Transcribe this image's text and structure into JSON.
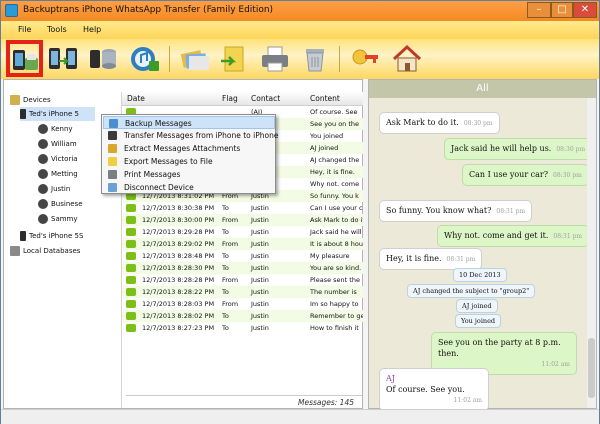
{
  "window": {
    "title": "Backuptrans iPhone WhatsApp Transfer (Family Edition)",
    "min": "–",
    "max": "□",
    "close": "✕"
  },
  "menu": [
    "File",
    "Tools",
    "Help"
  ],
  "toolbar": [
    "backup-messages-icon",
    "transfer-iphone-to-iphone-icon",
    "database-icon",
    "itunes-icon",
    "export-cards-icon",
    "folder-icon",
    "printer-icon",
    "recycle-bin-icon",
    "key-icon",
    "home-icon"
  ],
  "tree": {
    "devices": "Devices",
    "device1": "Ted's iPhone 5",
    "contacts": [
      "Kenny",
      "William",
      "Victoria",
      "Metting",
      "Justin",
      "Businese",
      "Sammy"
    ],
    "device2": "Ted's iPhone 5S",
    "local": "Local Databases"
  },
  "grid": {
    "columns": [
      "Date",
      "Flag",
      "Contact",
      "Content"
    ],
    "rows": [
      {
        "date": "12/7/2013 8:31:02 PM",
        "flag": "To",
        "contact": "Justin",
        "content": "Why not. come"
      },
      {
        "date": "12/7/2013 8:31:02 PM",
        "flag": "From",
        "contact": "Justin",
        "content": "So funny. You k"
      },
      {
        "date": "12/7/2013 8:30:38 PM",
        "flag": "To",
        "contact": "Justin",
        "content": "Can I use your c"
      },
      {
        "date": "12/7/2013 8:30:00 PM",
        "flag": "From",
        "contact": "Justin",
        "content": "Ask Mark to do it"
      },
      {
        "date": "12/7/2013 8:29:28 PM",
        "flag": "To",
        "contact": "Justin",
        "content": "Jack said he will"
      },
      {
        "date": "12/7/2013 8:29:02 PM",
        "flag": "From",
        "contact": "Justin",
        "content": "It is about 8 hou"
      },
      {
        "date": "12/7/2013 8:28:48 PM",
        "flag": "To",
        "contact": "Justin",
        "content": "My pleasure"
      },
      {
        "date": "12/7/2013 8:28:30 PM",
        "flag": "To",
        "contact": "Justin",
        "content": "You are so kind."
      },
      {
        "date": "12/7/2013 8:28:28 PM",
        "flag": "From",
        "contact": "Justin",
        "content": "Please sent the"
      },
      {
        "date": "12/7/2013 8:28:22 PM",
        "flag": "To",
        "contact": "Justin",
        "content": "The number is"
      },
      {
        "date": "12/7/2013 8:28:03 PM",
        "flag": "From",
        "contact": "Justin",
        "content": "Im so happy to"
      },
      {
        "date": "12/7/2013 8:28:02 PM",
        "flag": "To",
        "contact": "Justin",
        "content": "Remember to ge"
      },
      {
        "date": "12/7/2013 8:27:23 PM",
        "flag": "To",
        "contact": "Justin",
        "content": "How to finish it"
      }
    ],
    "top_rows": [
      {
        "date": "",
        "flag": "",
        "contact": "(AJ)",
        "content": "Of course. See"
      },
      {
        "date": "",
        "flag": "",
        "contact": "",
        "content": "See you on the"
      },
      {
        "date": "",
        "flag": "",
        "contact": "",
        "content": "You joined"
      },
      {
        "date": "",
        "flag": "",
        "contact": ">",
        "content": "AJ joined"
      },
      {
        "date": "",
        "flag": "",
        "contact": "",
        "content": "AJ changed the"
      },
      {
        "date": "",
        "flag": "",
        "contact": "",
        "content": "Hey, it is fine."
      }
    ],
    "count": "Messages: 145"
  },
  "context_menu": [
    {
      "label": "Backup Messages",
      "icon": "backup-icon"
    },
    {
      "label": "Transfer Messages from iPhone to iPhone",
      "icon": "transfer-icon"
    },
    {
      "label": "Extract Messages Attachments",
      "icon": "attachment-icon"
    },
    {
      "label": "Export Messages to File",
      "icon": "export-icon"
    },
    {
      "label": "Print Messages",
      "icon": "print-icon"
    },
    {
      "label": "Disconnect Device",
      "icon": "disconnect-icon"
    }
  ],
  "chat": {
    "header": "All",
    "bubbles": [
      {
        "text": "Ask Mark to do it.",
        "time": "08:30 pm",
        "side": "in"
      },
      {
        "text": "Jack said he will help us.",
        "time": "08:30 pm",
        "side": "out"
      },
      {
        "text": "Can I use your car?",
        "time": "08:30 pm",
        "side": "out"
      },
      {
        "text": "So funny. You know what?",
        "time": "08:31 pm",
        "side": "in"
      },
      {
        "text": "Why not. come and get it.",
        "time": "08:31 pm",
        "side": "out"
      },
      {
        "text": "Hey, it is fine.",
        "time": "08:31 pm",
        "side": "in"
      }
    ],
    "system": [
      "10 Dec 2013",
      "AJ changed the subject to \"group2\"",
      "AJ joined",
      "You joined"
    ],
    "last_out": {
      "text": "See you on the party at 8 p.m. then.",
      "time": "11:02 am"
    },
    "last_in": {
      "sender": "AJ",
      "text": "Of course. See you.",
      "time": "11:02 am"
    }
  }
}
